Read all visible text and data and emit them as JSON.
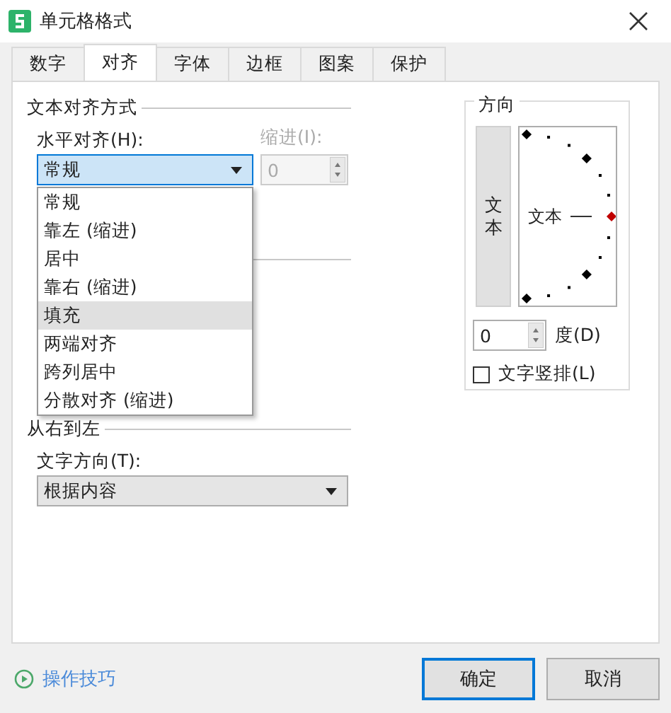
{
  "window": {
    "title": "单元格格式"
  },
  "tabs": [
    {
      "label": "数字",
      "selected": false
    },
    {
      "label": "对齐",
      "selected": true
    },
    {
      "label": "字体",
      "selected": false
    },
    {
      "label": "边框",
      "selected": false
    },
    {
      "label": "图案",
      "selected": false
    },
    {
      "label": "保护",
      "selected": false
    }
  ],
  "alignment": {
    "title": "文本对齐方式",
    "horizontal_label": "水平对齐(H):",
    "horizontal_value": "常规",
    "indent_label": "缩进(I):",
    "indent_value": "0",
    "indent_disabled": true
  },
  "dropdown": {
    "items": [
      {
        "label": "常规",
        "selected": false
      },
      {
        "label": "靠左 (缩进)",
        "selected": false
      },
      {
        "label": "居中",
        "selected": false
      },
      {
        "label": "靠右 (缩进)",
        "selected": false
      },
      {
        "label": "填充",
        "selected": true
      },
      {
        "label": "两端对齐",
        "selected": false
      },
      {
        "label": "跨列居中",
        "selected": false
      },
      {
        "label": "分散对齐 (缩进)",
        "selected": false
      }
    ]
  },
  "rtl": {
    "title": "从右到左",
    "direction_label": "文字方向(T):",
    "direction_value": "根据内容"
  },
  "orientation": {
    "title": "方向",
    "vertical_text": "文本",
    "dial_text": "文本",
    "degrees_value": "0",
    "degrees_label": "度(D)",
    "vertical_stack": {
      "label": "文字竖排(L)",
      "checked": false
    }
  },
  "footer": {
    "tips_link": "操作技巧",
    "buttons": [
      {
        "label": "确定",
        "kind": "default"
      },
      {
        "label": "取消",
        "kind": "normal"
      }
    ]
  }
}
